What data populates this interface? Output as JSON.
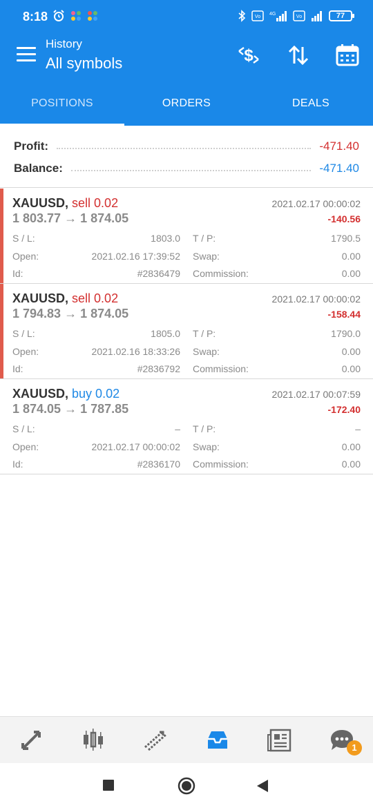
{
  "status": {
    "time": "8:18",
    "battery": "77",
    "network": "4G",
    "volte": "Vo LTE"
  },
  "header": {
    "subtitle": "History",
    "title": "All symbols"
  },
  "tabs": [
    {
      "label": "POSITIONS",
      "active": true
    },
    {
      "label": "ORDERS",
      "active": false
    },
    {
      "label": "DEALS",
      "active": false
    }
  ],
  "summary": {
    "profit_label": "Profit:",
    "profit_value": "-471.40",
    "balance_label": "Balance:",
    "balance_value": "-471.40"
  },
  "labels": {
    "sl": "S / L:",
    "tp": "T / P:",
    "open": "Open:",
    "swap": "Swap:",
    "id": "Id:",
    "commission": "Commission:"
  },
  "positions": [
    {
      "symbol": "XAUUSD,",
      "side": "sell 0.02",
      "side_color": "#d32f2f",
      "close_time": "2021.02.17 00:00:02",
      "prices": "1 803.77 → 1 874.05",
      "profit": "-140.56",
      "sl": "1803.0",
      "tp": "1790.5",
      "open": "2021.02.16 17:39:52",
      "swap": "0.00",
      "id": "#2836479",
      "commission": "0.00",
      "marker": true
    },
    {
      "symbol": "XAUUSD,",
      "side": "sell 0.02",
      "side_color": "#d32f2f",
      "close_time": "2021.02.17 00:00:02",
      "prices": "1 794.83 → 1 874.05",
      "profit": "-158.44",
      "sl": "1805.0",
      "tp": "1790.0",
      "open": "2021.02.16 18:33:26",
      "swap": "0.00",
      "id": "#2836792",
      "commission": "0.00",
      "marker": true
    },
    {
      "symbol": "XAUUSD,",
      "side": "buy 0.02",
      "side_color": "#1e88e5",
      "close_time": "2021.02.17 00:07:59",
      "prices": "1 874.05 → 1 787.85",
      "profit": "-172.40",
      "sl": "–",
      "tp": "–",
      "open": "2021.02.17 00:00:02",
      "swap": "0.00",
      "id": "#2836170",
      "commission": "0.00",
      "marker": false
    }
  ],
  "bottom_nav": [
    {
      "icon": "quotes-icon"
    },
    {
      "icon": "chart-icon"
    },
    {
      "icon": "trade-icon"
    },
    {
      "icon": "history-icon",
      "active": true
    },
    {
      "icon": "news-icon"
    },
    {
      "icon": "messages-icon",
      "badge": "1"
    }
  ],
  "colors": {
    "accent": "#1a88e8",
    "loss": "#d32f2f",
    "balance": "#1e88e5",
    "marker": "#e05b4c"
  }
}
